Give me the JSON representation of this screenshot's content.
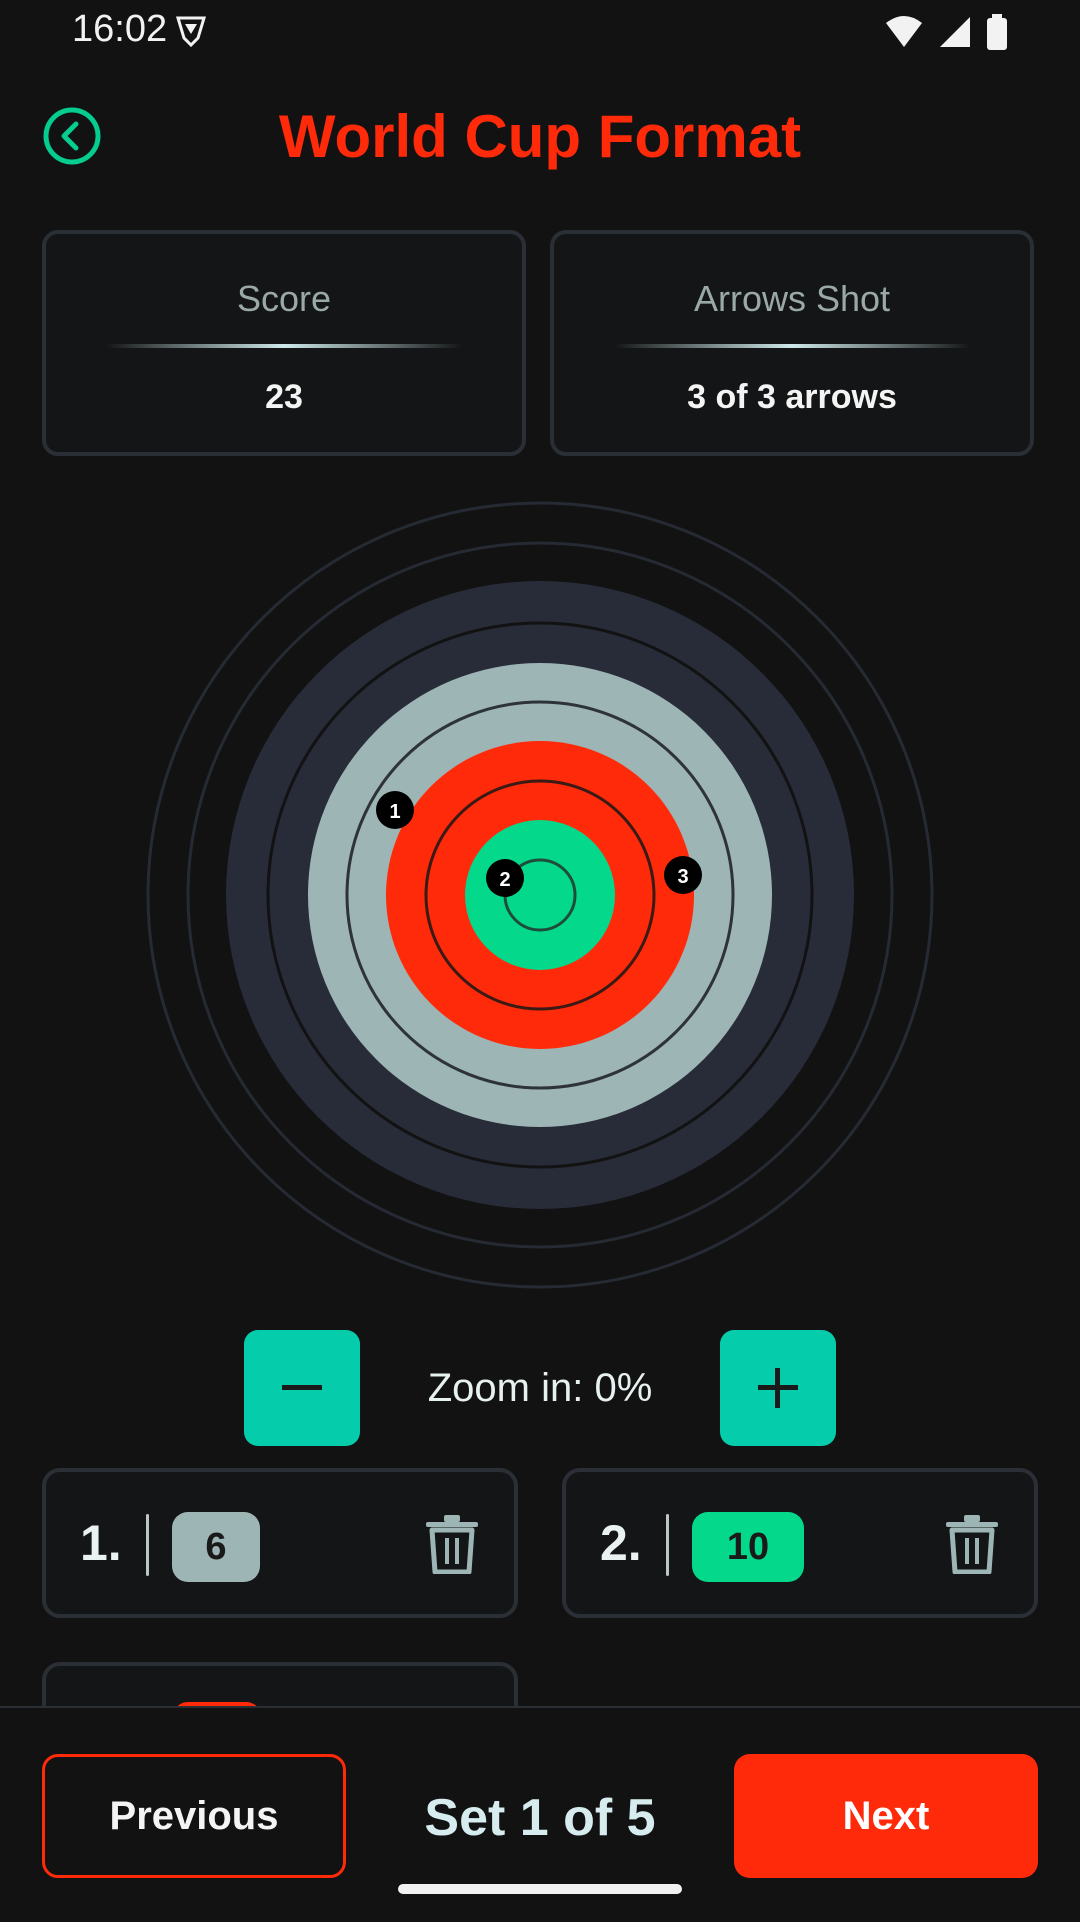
{
  "status_bar": {
    "time": "16:02"
  },
  "header": {
    "title": "World Cup Format"
  },
  "stats": {
    "score_label": "Score",
    "score_value": "23",
    "arrows_label": "Arrows Shot",
    "arrows_value": "3 of 3 arrows"
  },
  "target": {
    "markers": [
      {
        "label": "1"
      },
      {
        "label": "2"
      },
      {
        "label": "3"
      }
    ]
  },
  "zoom": {
    "label": "Zoom in: 0%"
  },
  "arrows": [
    {
      "number": "1.",
      "score": "6"
    },
    {
      "number": "2.",
      "score": "10"
    }
  ],
  "footer": {
    "previous_label": "Previous",
    "set_label": "Set 1 of 5",
    "next_label": "Next"
  },
  "colors": {
    "accent_red": "#ff2a0a",
    "accent_teal": "#05ccaa",
    "accent_green": "#04d98b",
    "ring_gray": "#9db5b4",
    "ring_dark": "#272c38"
  }
}
